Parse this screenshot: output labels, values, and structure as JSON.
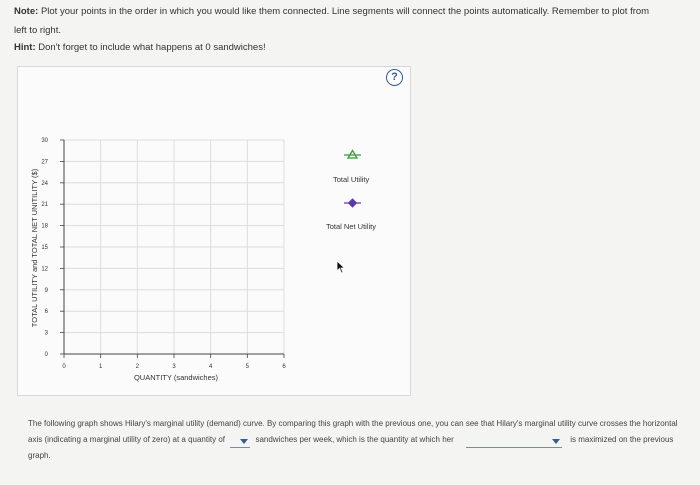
{
  "note": {
    "label": "Note",
    "text": "Plot your points in the order in which you would like them connected. Line segments will connect the points automatically. Remember to plot from left to right."
  },
  "hint": {
    "label": "Hint",
    "text": "Don't forget to include what happens at 0 sandwiches!"
  },
  "help_button": {
    "label": "?"
  },
  "chart_data": {
    "type": "line",
    "ylabel": "TOTAL UTILITY and TOTAL NET UNITILITY ($)",
    "xlabel": "QUANTITY (sandwiches)",
    "x_ticks": [
      "0",
      "1",
      "2",
      "3",
      "4",
      "5",
      "6"
    ],
    "y_ticks": [
      "0",
      "3",
      "6",
      "9",
      "12",
      "15",
      "18",
      "21",
      "24",
      "27",
      "30"
    ],
    "xlim": [
      0,
      6
    ],
    "ylim": [
      0,
      30
    ],
    "grid": true,
    "series": []
  },
  "legend": {
    "items": [
      {
        "label": "Total Utility",
        "color": "#3a9a3a",
        "marker": "triangle"
      },
      {
        "label": "Total Net Utility",
        "color": "#5a3aa8",
        "marker": "diamond"
      }
    ]
  },
  "question": {
    "part1": "The following graph shows Hilary's marginal utility (demand) curve. By comparing this graph with the previous one, you can see that Hilary's marginal utility curve crosses the horizontal axis (indicating a marginal utility of zero) at a quantity of",
    "part2": "sandwiches per week, which is the quantity at which her",
    "part3": "is maximized on the previous graph.",
    "dropdown1_value": "",
    "dropdown2_value": ""
  }
}
